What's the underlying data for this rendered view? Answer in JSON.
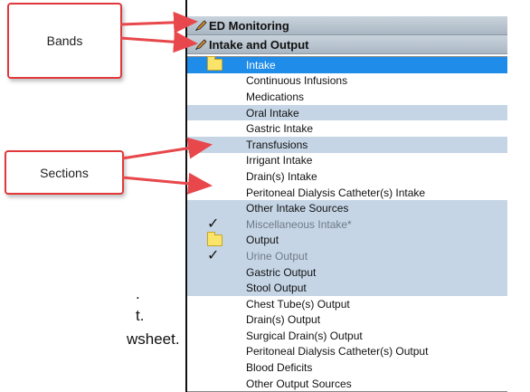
{
  "callouts": {
    "bands": "Bands",
    "sections": "Sections"
  },
  "left_fragments": [
    ".",
    "t.",
    "wsheet."
  ],
  "bands": [
    {
      "label": "ED Monitoring",
      "icon": "pencil-icon"
    },
    {
      "label": "Intake and Output",
      "icon": "pencil-icon"
    }
  ],
  "sections": [
    {
      "label": "Intake",
      "icon": "folder-icon",
      "state": "selected"
    },
    {
      "label": "Continuous Infusions",
      "state": "normal"
    },
    {
      "label": "Medications",
      "state": "normal"
    },
    {
      "label": "Oral Intake",
      "state": "highlight"
    },
    {
      "label": "Gastric Intake",
      "state": "normal"
    },
    {
      "label": "Transfusions",
      "state": "highlight"
    },
    {
      "label": "Irrigant Intake",
      "state": "normal"
    },
    {
      "label": "Drain(s) Intake",
      "state": "normal"
    },
    {
      "label": "Peritoneal Dialysis Catheter(s) Intake",
      "state": "normal"
    },
    {
      "label": "Other Intake Sources",
      "state": "highlight"
    },
    {
      "label": "Miscellaneous Intake*",
      "icon": "checkmark-icon",
      "state": "highlight-grey"
    },
    {
      "label": "Output",
      "icon": "folder-icon",
      "state": "highlight"
    },
    {
      "label": "Urine Output",
      "icon": "checkmark-icon",
      "state": "highlight-grey"
    },
    {
      "label": "Gastric Output",
      "state": "highlight"
    },
    {
      "label": "Stool Output",
      "state": "highlight"
    },
    {
      "label": "Chest Tube(s) Output",
      "state": "normal"
    },
    {
      "label": "Drain(s) Output",
      "state": "normal"
    },
    {
      "label": "Surgical Drain(s) Output",
      "state": "normal"
    },
    {
      "label": "Peritoneal Dialysis Catheter(s) Output",
      "state": "normal"
    },
    {
      "label": "Blood Deficits",
      "state": "normal"
    },
    {
      "label": "Other Output Sources",
      "state": "normal"
    }
  ],
  "colors": {
    "callout_border": "#e0383b",
    "selected": "#1e8ce8",
    "highlight": "#c5d5e6",
    "arrow": "#e8474b"
  }
}
